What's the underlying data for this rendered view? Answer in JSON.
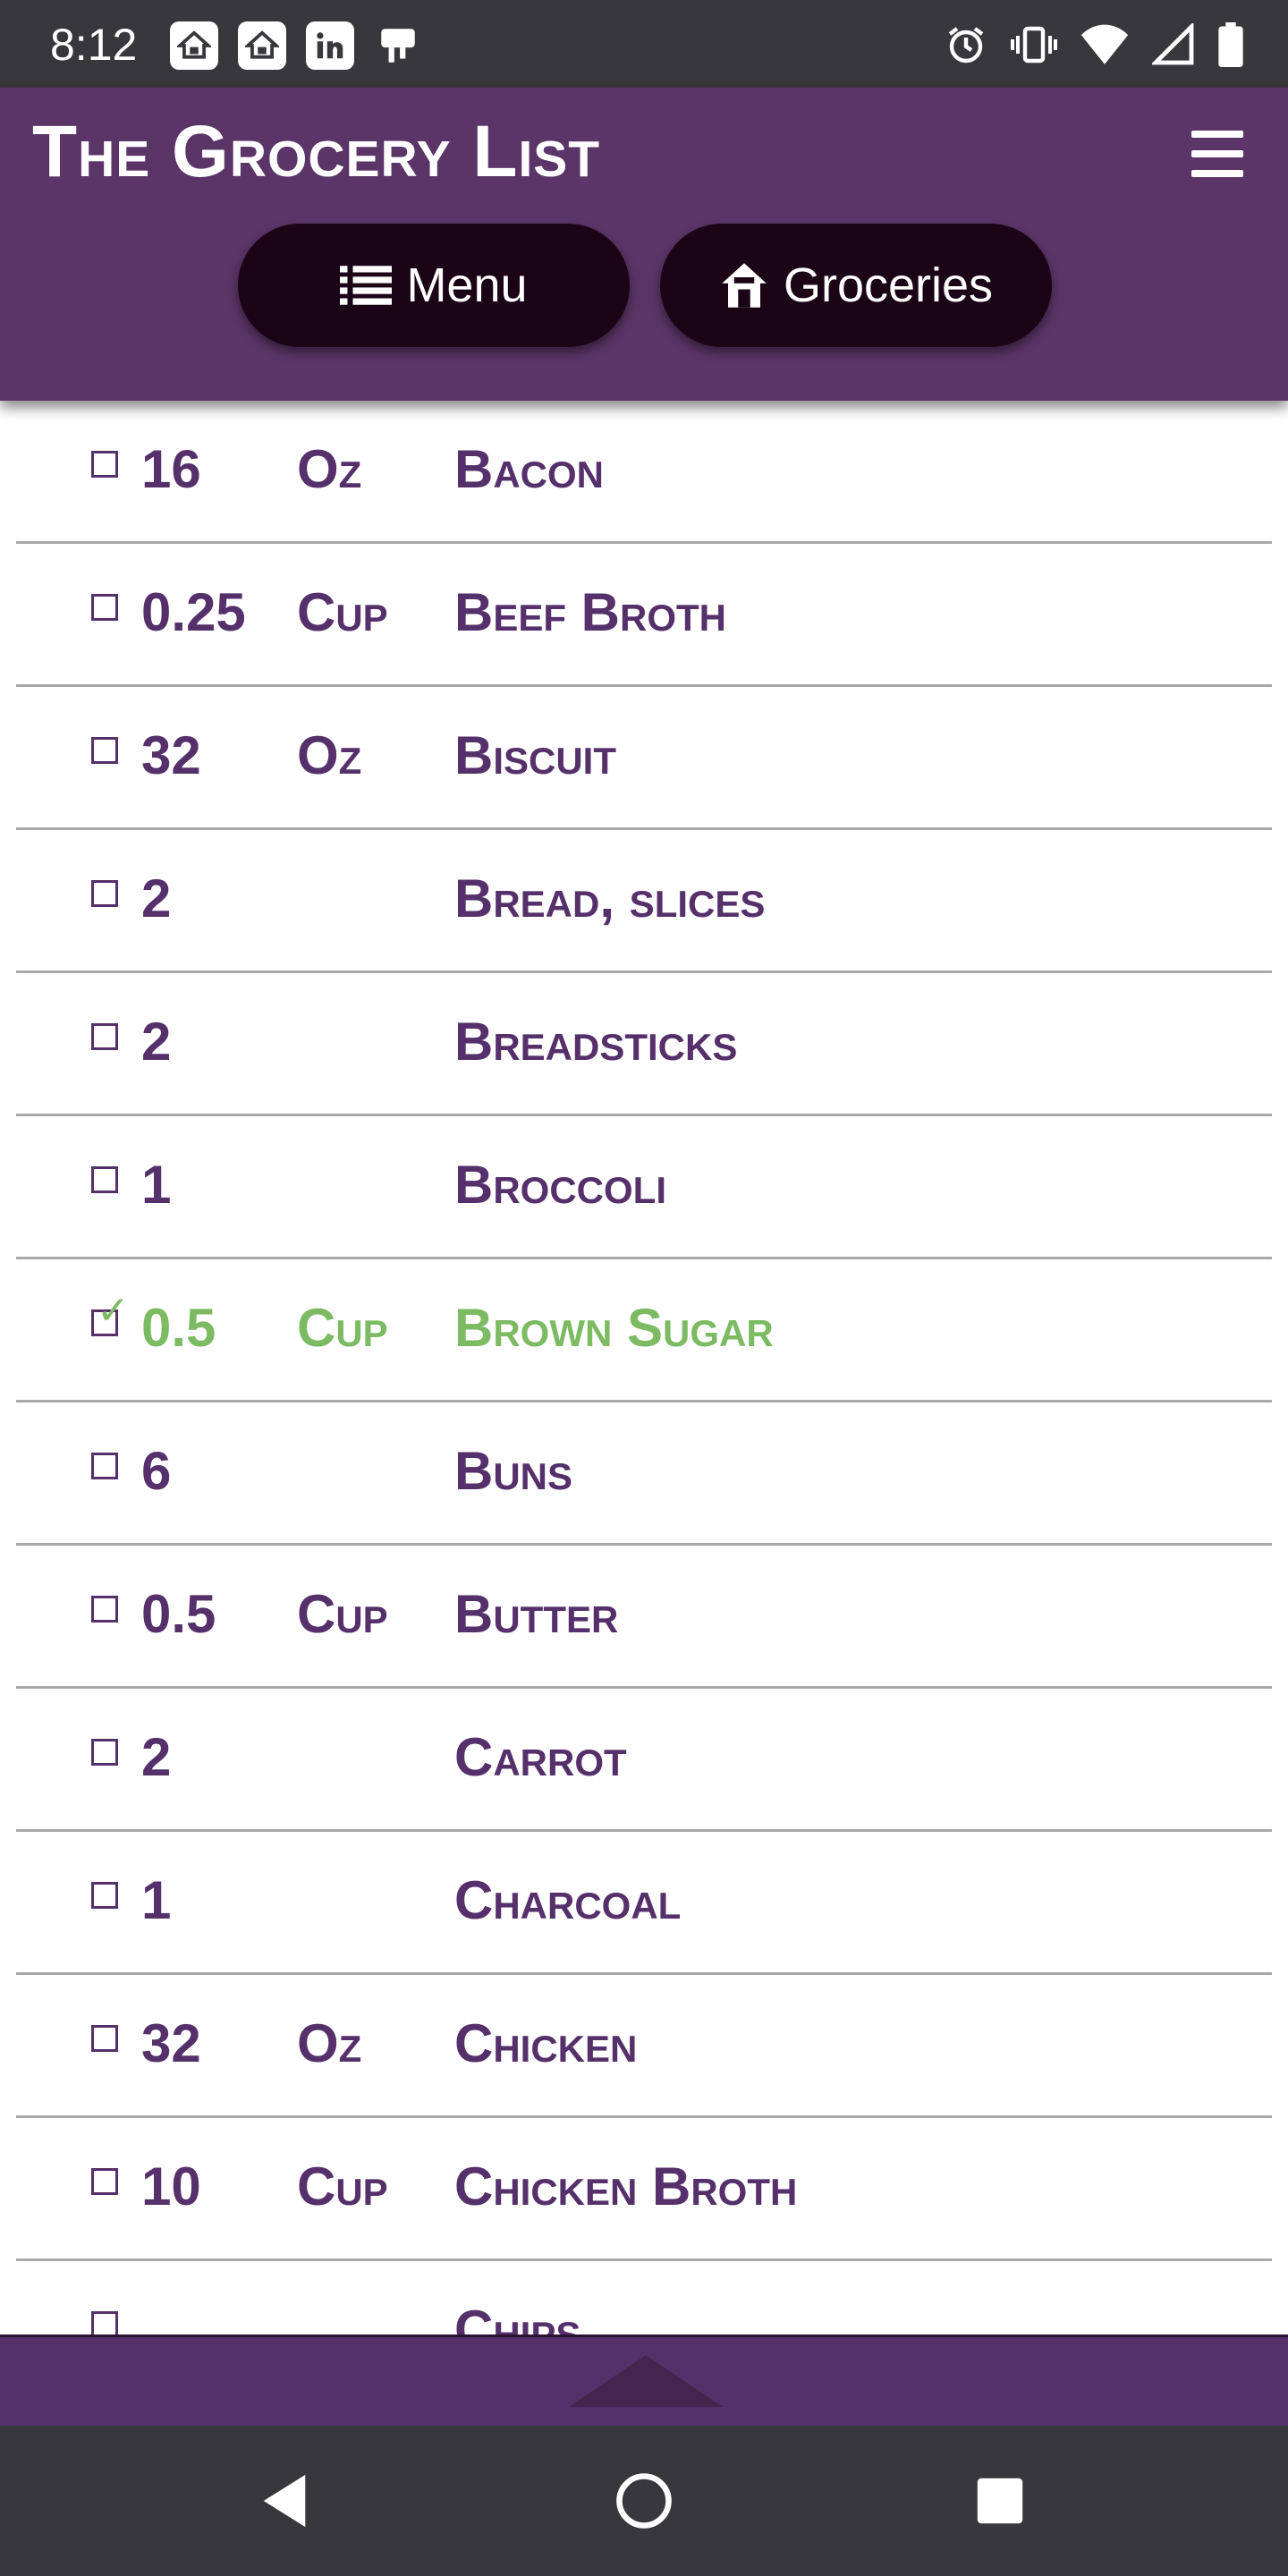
{
  "status_bar": {
    "time": "8:12",
    "notification_icons": [
      "home-icon",
      "home-icon",
      "linkedin-icon",
      "sim-card-icon"
    ],
    "system_icons": [
      "alarm-icon",
      "vibrate-icon",
      "wifi-icon",
      "signal-icon",
      "battery-icon"
    ]
  },
  "header": {
    "title": "The Grocery List",
    "menu_icon": "hamburger-icon",
    "buttons": {
      "menu_label": "Menu",
      "menu_icon": "list-icon",
      "groceries_label": "Groceries",
      "groceries_icon": "store-icon"
    }
  },
  "colors": {
    "header_bg": "#5b3568",
    "button_bg": "#1a0416",
    "item_text": "#55306a",
    "checked_text": "#7dbb63",
    "status_bar_bg": "#38373c"
  },
  "grocery_list": [
    {
      "checked": false,
      "qty": "16",
      "unit": "Oz",
      "name": "Bacon"
    },
    {
      "checked": false,
      "qty": "0.25",
      "unit": "Cup",
      "name": "Beef Broth"
    },
    {
      "checked": false,
      "qty": "32",
      "unit": "Oz",
      "name": "Biscuit"
    },
    {
      "checked": false,
      "qty": "2",
      "unit": "",
      "name": "Bread, slices"
    },
    {
      "checked": false,
      "qty": "2",
      "unit": "",
      "name": "Breadsticks"
    },
    {
      "checked": false,
      "qty": "1",
      "unit": "",
      "name": "Broccoli"
    },
    {
      "checked": true,
      "qty": "0.5",
      "unit": "Cup",
      "name": "Brown Sugar"
    },
    {
      "checked": false,
      "qty": "6",
      "unit": "",
      "name": "Buns"
    },
    {
      "checked": false,
      "qty": "0.5",
      "unit": "Cup",
      "name": "Butter"
    },
    {
      "checked": false,
      "qty": "2",
      "unit": "",
      "name": "Carrot"
    },
    {
      "checked": false,
      "qty": "1",
      "unit": "",
      "name": "Charcoal"
    },
    {
      "checked": false,
      "qty": "32",
      "unit": "Oz",
      "name": "Chicken"
    },
    {
      "checked": false,
      "qty": "10",
      "unit": "Cup",
      "name": "Chicken Broth"
    },
    {
      "checked": false,
      "qty": "",
      "unit": "",
      "name": "Chips"
    }
  ],
  "footer": {
    "scroll_icon": "scroll-to-top-icon"
  },
  "nav_bar": {
    "icons": [
      "back-icon",
      "home-circle-icon",
      "recents-icon"
    ]
  }
}
